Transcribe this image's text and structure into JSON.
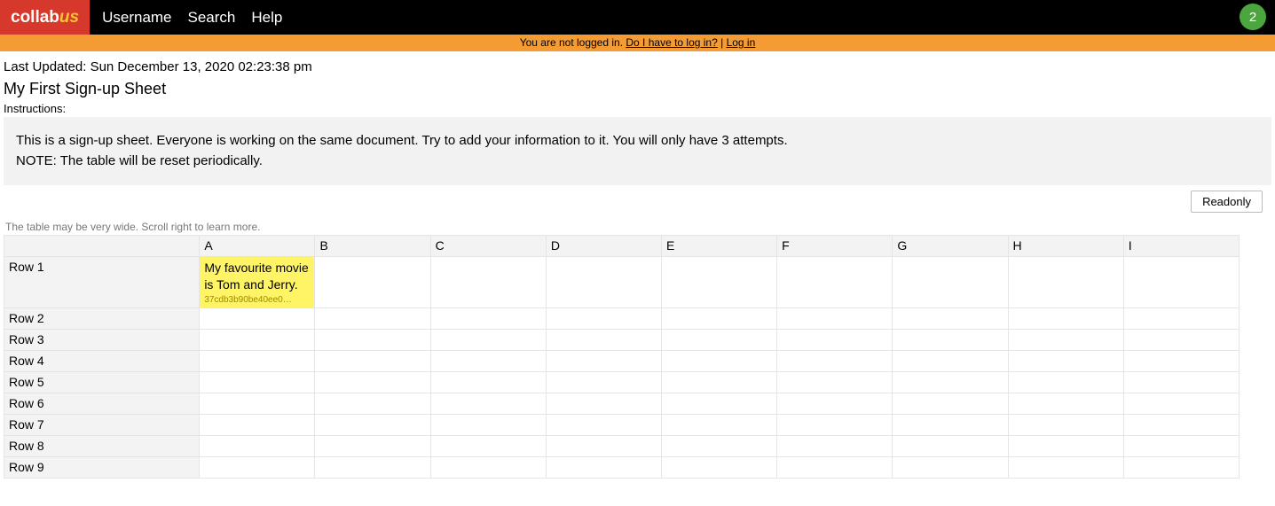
{
  "brand": {
    "part1": "collab",
    "part2": "us"
  },
  "nav": {
    "username": "Username",
    "search": "Search",
    "help": "Help"
  },
  "badge_count": "2",
  "notice": {
    "prefix": "You are not logged in. ",
    "link1": "Do I have to log in?",
    "sep": " | ",
    "link2": "Log in"
  },
  "meta": {
    "last_updated": "Last Updated: Sun December 13, 2020 02:23:38 pm",
    "title": "My First Sign-up Sheet",
    "instructions_label": "Instructions:",
    "instructions_line1": "This is a sign-up sheet. Everyone is working on the same document. Try to add your information to it. You will only have 3 attempts.",
    "instructions_line2": "NOTE: The table will be reset periodically."
  },
  "readonly_label": "Readonly",
  "scroll_hint": "The table may be very wide. Scroll right to learn more.",
  "columns": [
    "A",
    "B",
    "C",
    "D",
    "E",
    "F",
    "G",
    "H",
    "I"
  ],
  "rows": [
    "Row 1",
    "Row 2",
    "Row 3",
    "Row 4",
    "Row 5",
    "Row 6",
    "Row 7",
    "Row 8",
    "Row 9"
  ],
  "cells": {
    "r1cA": {
      "text": "My favourite movie is Tom and Jerry.",
      "meta": "37cdb3b90be40ee0…"
    }
  }
}
